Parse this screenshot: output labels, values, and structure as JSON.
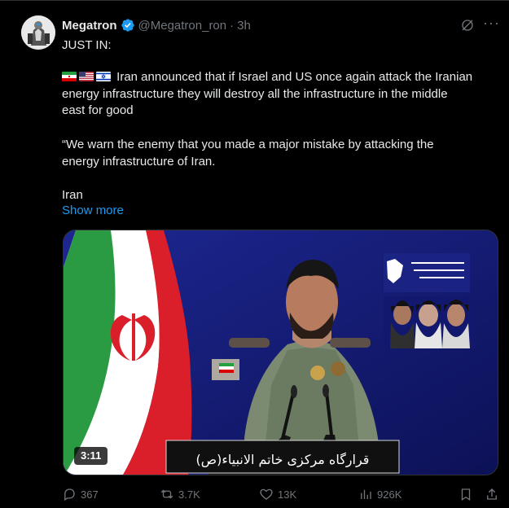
{
  "tweet": {
    "author_name": "Megatron",
    "handle": "@Megatron_ron",
    "separator": "·",
    "time": "3h",
    "lines": [
      "JUST IN:",
      "Iran announced that if Israel and US once again attack the Iranian",
      "energy infrastructure they will destroy all the infrastructure in the middle",
      "east for good",
      "“We warn the enemy that you made a major mistake by attacking the",
      "energy infrastructure of Iran.",
      "Iran"
    ],
    "show_more": "Show more",
    "flags": [
      "iran-flag-icon",
      "us-flag-icon",
      "israel-flag-icon"
    ]
  },
  "media": {
    "duration": "3:11",
    "caption": "قرارگاه مرکزی خاتم الانبیاء(ص)"
  },
  "actions": {
    "replies": "367",
    "reposts": "3.7K",
    "likes": "13K",
    "views": "926K"
  },
  "colors": {
    "background": "#000000",
    "text": "#e7e9ea",
    "muted": "#71767b",
    "link": "#1d9bf0",
    "verified": "#1d9bf0"
  }
}
